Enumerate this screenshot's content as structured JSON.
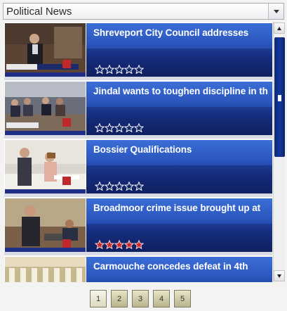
{
  "dropdown": {
    "label": "Political News",
    "icon": "chevron-down-icon"
  },
  "items": [
    {
      "title": "Shreveport City Council addresses",
      "rating": 0
    },
    {
      "title": "Jindal wants to toughen discipline in th",
      "rating": 0
    },
    {
      "title": "Bossier Qualifications",
      "rating": 0
    },
    {
      "title": "Broadmoor crime issue brought up at",
      "rating": 5
    },
    {
      "title": "Carmouche concedes defeat in 4th",
      "rating": 0
    }
  ],
  "rating_max": 5,
  "colors": {
    "star_filled": "#c8262a",
    "star_empty": "#ffffff",
    "accent": "#2b56bd"
  },
  "pager": {
    "pages": [
      "1",
      "2",
      "3",
      "4",
      "5"
    ],
    "current": "1"
  }
}
